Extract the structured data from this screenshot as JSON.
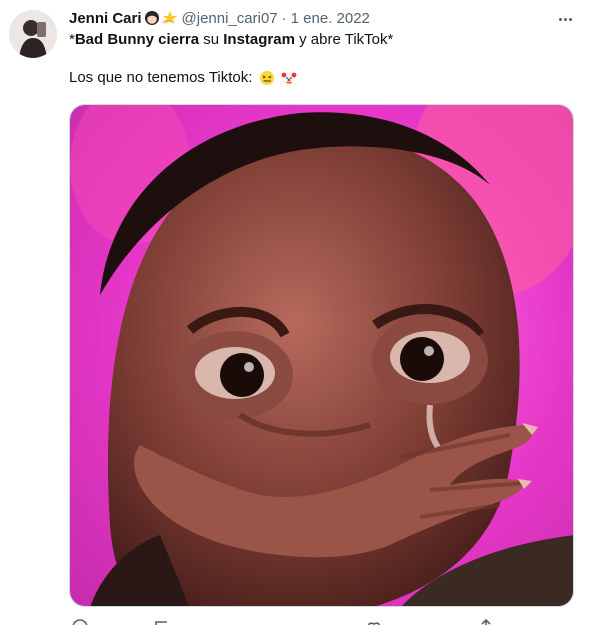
{
  "tweet": {
    "author_name": "Jenni Cari",
    "handle": "@jenni_cari07",
    "separator": "·",
    "date": "1 ene. 2022",
    "line1": [
      {
        "text": "*",
        "bold": false
      },
      {
        "text": "Bad Bunny cierra",
        "bold": true
      },
      {
        "text": " su ",
        "bold": false
      },
      {
        "text": "Instagram",
        "bold": true
      },
      {
        "text": " y abre TikTok*",
        "bold": false
      }
    ],
    "line2_text": "Los que no tenemos Tiktok:",
    "name_emojis": [
      "woman-emoji",
      "dizzy-star-emoji"
    ],
    "line2_emojis": [
      "confounded-face-emoji",
      "clown-face-emoji"
    ],
    "actions": [
      "reply-icon",
      "retweet-icon",
      "like-icon",
      "share-icon"
    ]
  },
  "colors": {
    "text": "#0f1419",
    "secondary": "#536471",
    "media_background": "#e637c8"
  }
}
